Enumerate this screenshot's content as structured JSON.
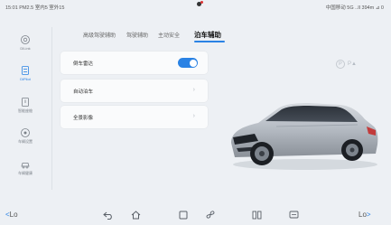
{
  "status": {
    "left": "15:01 PM2.5 室内5 室外15",
    "right": "中国移动 5G ..Il 394m ⊿ 0"
  },
  "sidebar": {
    "items": [
      {
        "label": "DILink",
        "icon": "dilink-icon",
        "active": false
      },
      {
        "label": "DiPilot",
        "icon": "dipilot-icon",
        "active": true
      },
      {
        "label": "智能座舱",
        "icon": "cockpit-icon",
        "active": false
      },
      {
        "label": "车辆设置",
        "icon": "car-settings-icon",
        "active": false
      },
      {
        "label": "车辆健康",
        "icon": "car-health-icon",
        "active": false
      }
    ]
  },
  "tabs": [
    {
      "label": "高级驾驶辅助",
      "active": false
    },
    {
      "label": "驾驶辅助",
      "active": false
    },
    {
      "label": "主动安全",
      "active": false
    },
    {
      "label": "泊车辅助",
      "active": true
    }
  ],
  "settings": {
    "reverse_radar": {
      "label": "倒车雷达",
      "enabled": true
    },
    "auto_parking": {
      "label": "自动泊车"
    },
    "panoramic": {
      "label": "全景影像"
    }
  },
  "parking_indicator": {
    "text": "P",
    "suffix": "P▲"
  },
  "climate": {
    "left_temp": "Lo",
    "right_temp": "Lo"
  },
  "colors": {
    "accent": "#2a82e4",
    "background": "#edf0f4"
  }
}
